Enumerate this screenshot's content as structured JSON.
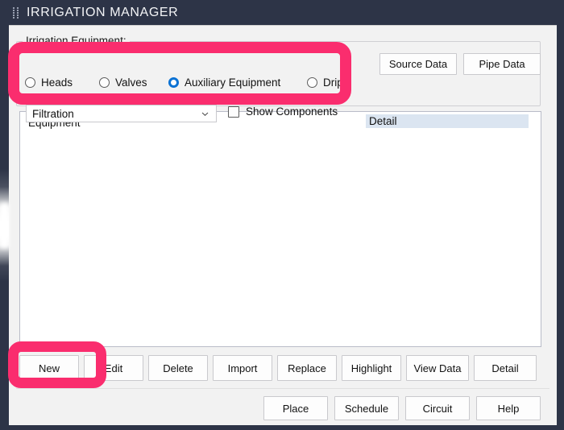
{
  "window": {
    "title": "IRRIGATION MANAGER",
    "grip_icon": "drag-handle-icon",
    "titlebar_color": "#2d3447"
  },
  "equipment_group": {
    "legend": "Irrigation Equipment:",
    "radios": [
      {
        "label": "Heads",
        "selected": false
      },
      {
        "label": "Valves",
        "selected": false
      },
      {
        "label": "Auxiliary Equipment",
        "selected": true
      },
      {
        "label": "Drip",
        "selected": false
      }
    ],
    "type_select": {
      "value": "Filtration",
      "chevron_icon": "chevron-down-icon"
    },
    "show_components": {
      "label": "Show Components",
      "checked": false
    }
  },
  "top_right_buttons": [
    {
      "label": "Source Data"
    },
    {
      "label": "Pipe Data"
    }
  ],
  "list_panel": {
    "equipment_header": "Equipment",
    "detail_header": "Detail",
    "detail_header_bg": "#dbe5f1",
    "rows": []
  },
  "action_buttons": [
    {
      "label": "New",
      "highlighted": true
    },
    {
      "label": "Edit",
      "highlighted": false
    },
    {
      "label": "Delete",
      "highlighted": false
    },
    {
      "label": "Import",
      "highlighted": false
    },
    {
      "label": "Replace",
      "highlighted": false
    },
    {
      "label": "Highlight",
      "highlighted": false
    },
    {
      "label": "View Data",
      "highlighted": false
    },
    {
      "label": "Detail",
      "highlighted": false
    }
  ],
  "footer_buttons": [
    {
      "label": "Place"
    },
    {
      "label": "Schedule"
    },
    {
      "label": "Circuit"
    },
    {
      "label": "Help"
    }
  ],
  "annotations": {
    "color": "#fa2d6e",
    "regions": [
      {
        "name": "equipment-options-highlight"
      },
      {
        "name": "new-button-highlight"
      }
    ]
  }
}
